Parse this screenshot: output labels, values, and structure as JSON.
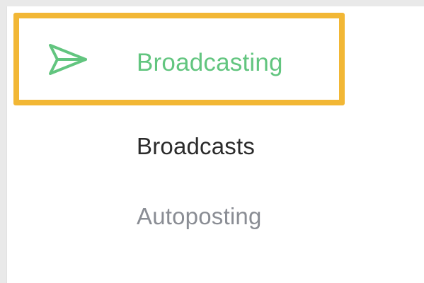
{
  "nav": {
    "header": {
      "label": "Broadcasting",
      "icon": "send-icon",
      "accent_color": "#62c57f",
      "highlight_color": "#f2b735"
    },
    "items": [
      {
        "label": "Broadcasts",
        "state": "active",
        "color": "#2b2b2b"
      },
      {
        "label": "Autoposting",
        "state": "inactive",
        "color": "#8a8d94"
      }
    ]
  }
}
